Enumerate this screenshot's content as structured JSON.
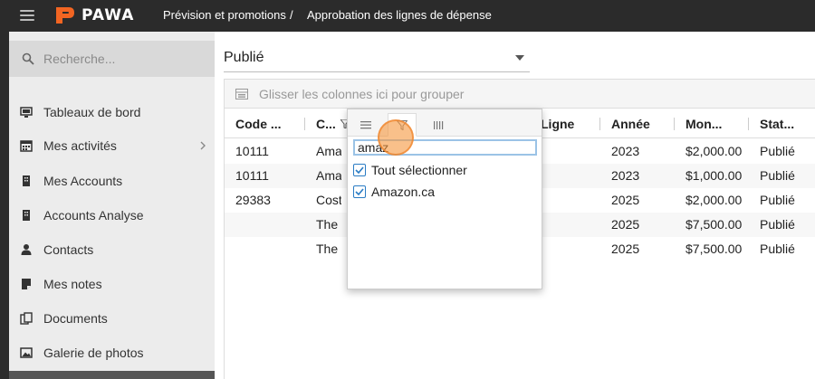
{
  "header": {
    "brand": "PAWA",
    "breadcrumb": [
      "Prévision et promotions",
      "/",
      "Approbation des lignes de dépense"
    ]
  },
  "colors": {
    "brand": "#f26522",
    "topbar": "#2b2b2b",
    "sidebar": "#ececec",
    "checkbox": "#2a7cc4"
  },
  "sidebar": {
    "search_placeholder": "Recherche...",
    "items": [
      {
        "label": "Tableaux de bord",
        "icon": "monitor-icon"
      },
      {
        "label": "Mes activités",
        "icon": "calendar-icon",
        "has_submenu": true
      },
      {
        "label": "Mes Accounts",
        "icon": "building-icon"
      },
      {
        "label": "Accounts Analyse",
        "icon": "building-icon"
      },
      {
        "label": "Contacts",
        "icon": "person-icon"
      },
      {
        "label": "Mes notes",
        "icon": "note-icon"
      },
      {
        "label": "Documents",
        "icon": "documents-icon"
      },
      {
        "label": "Galerie de photos",
        "icon": "image-icon"
      }
    ]
  },
  "main": {
    "status_select": "Publié",
    "group_panel": "Glisser les colonnes ici pour grouper",
    "columns": [
      "Code ...",
      "C...",
      "Ligne",
      "Année",
      "Mon...",
      "Stat..."
    ],
    "rows": [
      [
        "10111",
        "Amaz",
        "",
        "2023",
        "$2,000.00",
        "Publié"
      ],
      [
        "10111",
        "Amaz",
        "",
        "2023",
        "$1,000.00",
        "Publié"
      ],
      [
        "29383",
        "Costc",
        "",
        "2025",
        "$2,000.00",
        "Publié"
      ],
      [
        "",
        "The R",
        "",
        "2025",
        "$7,500.00",
        "Publié"
      ],
      [
        "",
        "The R",
        "",
        "2025",
        "$7,500.00",
        "Publié"
      ]
    ]
  },
  "filter_popup": {
    "tabs": [
      "menu-tab",
      "filter-tab",
      "columns-tab"
    ],
    "search_value": "amaz",
    "options": [
      {
        "label": "Tout sélectionner",
        "checked": true
      },
      {
        "label": "Amazon.ca",
        "checked": true
      }
    ]
  }
}
